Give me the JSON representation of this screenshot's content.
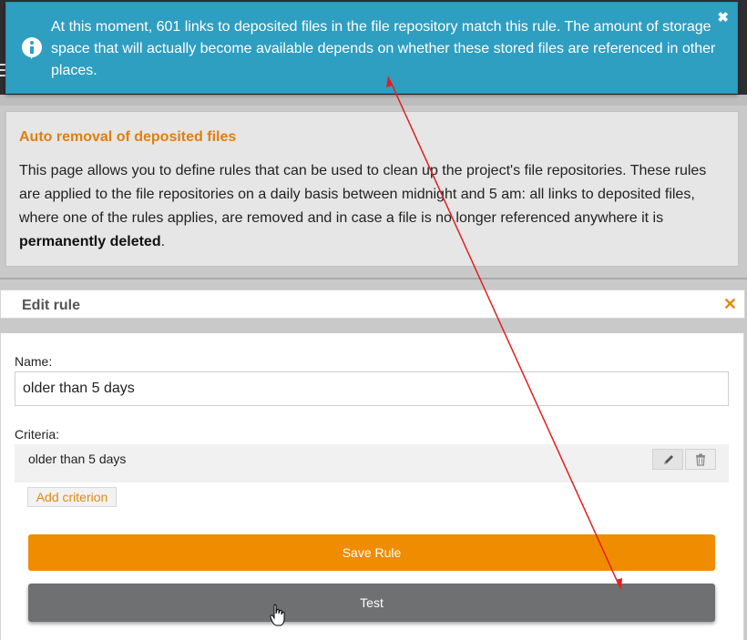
{
  "notification": {
    "message": "At this moment, 601 links to deposited files in the file repository match this rule. The amount of storage space that will actually become available depends on whether these stored files are referenced in other places.",
    "close_glyph": "✖",
    "icon": "info-icon"
  },
  "description": {
    "title": "Auto removal of deposited files",
    "text": "This page allows you to define rules that can be used to clean up the project's file repositories. These rules are applied to the file repositories on a daily basis between midnight and 5 am: all links to deposited files, where one of the rules applies, are removed and in case a file is no longer referenced anywhere it is ",
    "text_bold": "permanently deleted",
    "text_end": "."
  },
  "dialog": {
    "title": "Edit rule",
    "close_glyph": "✕",
    "name_label": "Name:",
    "name_value": "older than 5 days",
    "criteria_label": "Criteria:",
    "criteria": [
      {
        "text": "older than 5 days",
        "edit_icon": "pencil-icon",
        "delete_icon": "trash-icon"
      }
    ],
    "add_criterion_label": "Add criterion",
    "save_label": "Save Rule",
    "test_label": "Test"
  },
  "colors": {
    "notification_bg": "#2e9ec1",
    "accent_orange": "#ef8c00",
    "title_orange": "#e07f0d",
    "test_button": "#6e7072",
    "annotation_arrow": "#e02020"
  }
}
